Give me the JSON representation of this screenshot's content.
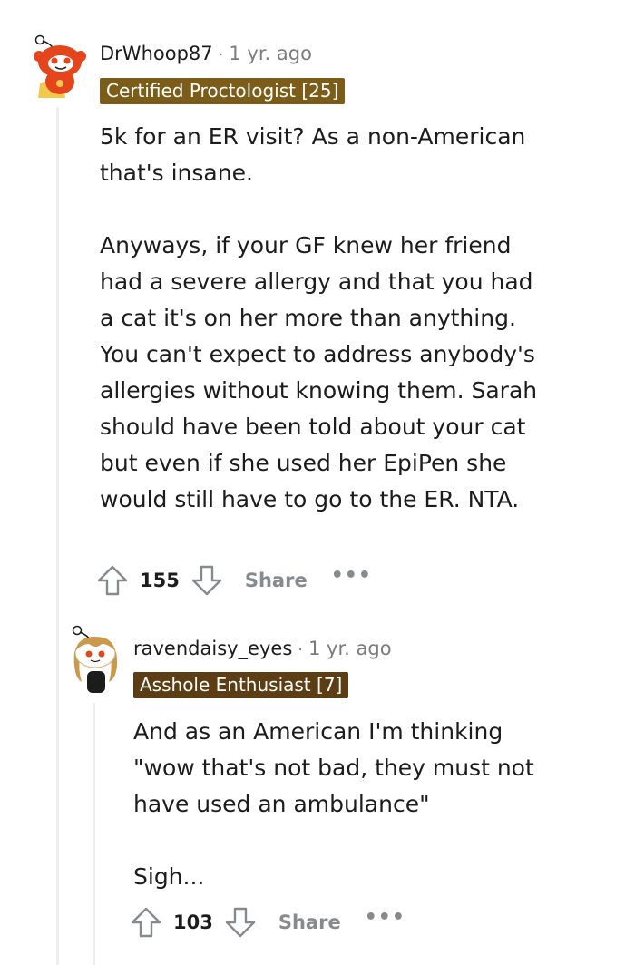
{
  "comments": [
    {
      "username": "DrWhoop87",
      "time": "1 yr. ago",
      "flair": "Certified Proctologist [25]",
      "flair_color": "#7c5c19",
      "paragraphs": [
        "5k for an ER visit? As a non-American that's insane.",
        "Anyways, if your GF knew her friend had a severe allergy and that you had a cat it's on her more than anything. You can't expect to address anybody's allergies without knowing them. Sarah should have been told about your cat but even if she used her EpiPen she would still have to go to the ER. NTA."
      ],
      "score": "155",
      "share_label": "Share",
      "more_label": "•••",
      "avatar_icon": "snoo-avatar-red-icon"
    },
    {
      "username": "ravendaisy_eyes",
      "time": "1 yr. ago",
      "flair": "Asshole Enthusiast [7]",
      "flair_color": "#5c3d14",
      "paragraphs": [
        "And as an American I'm thinking \"wow that's not bad, they must not have used an ambulance\"",
        "Sigh..."
      ],
      "score": "103",
      "share_label": "Share",
      "more_label": "•••",
      "avatar_icon": "snoo-avatar-blonde-icon"
    }
  ],
  "separator": "·"
}
